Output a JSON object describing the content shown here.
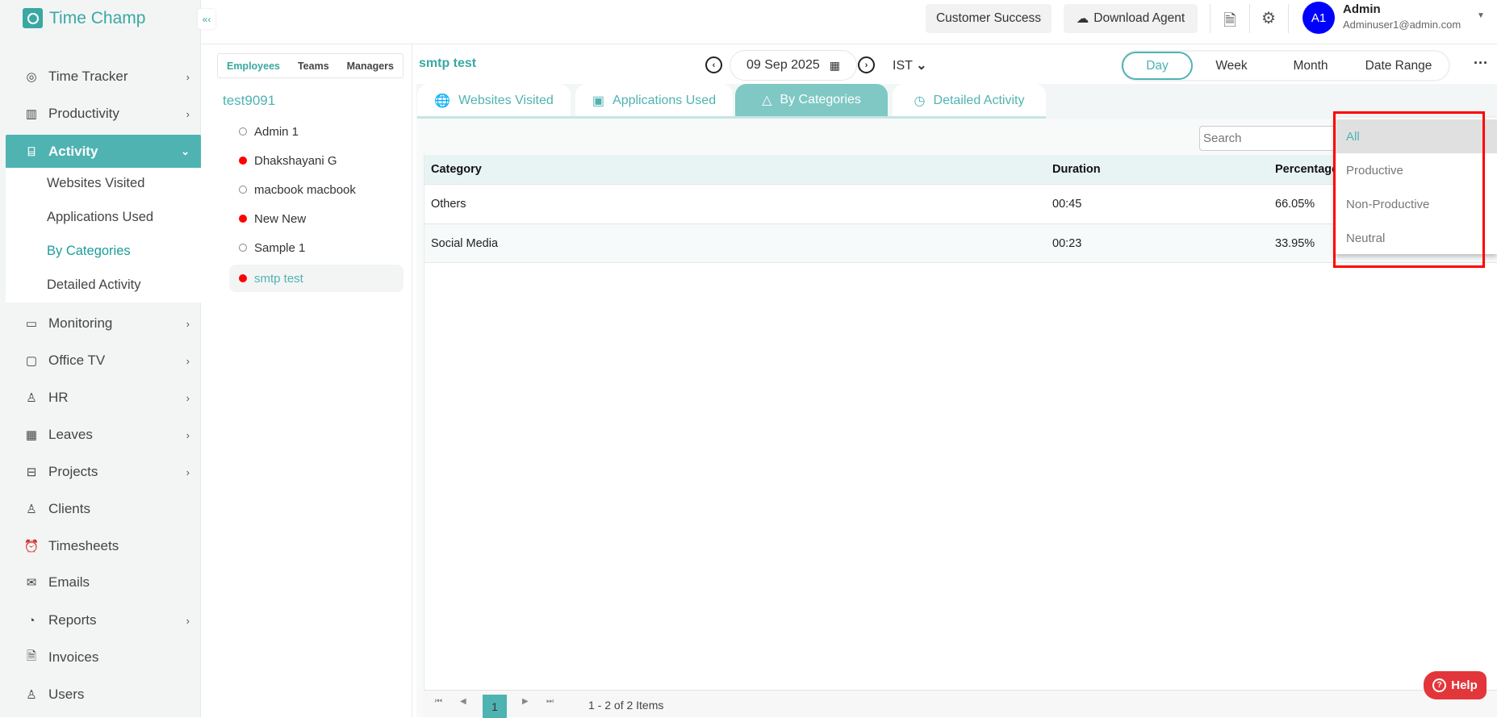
{
  "app": {
    "name": "Time Champ"
  },
  "header": {
    "customer_success": "Customer Success",
    "download_agent": "Download Agent",
    "user": {
      "initials": "A1",
      "name": "Admin",
      "email": "Adminuser1@admin.com"
    }
  },
  "sidebar": {
    "items": [
      {
        "label": "Time Tracker",
        "icon": "timer-icon"
      },
      {
        "label": "Productivity",
        "icon": "chart-icon"
      },
      {
        "label": "Activity",
        "icon": "ticket-icon"
      },
      {
        "label": "Monitoring",
        "icon": "monitor-icon"
      },
      {
        "label": "Office TV",
        "icon": "tv-icon"
      },
      {
        "label": "HR",
        "icon": "person-icon"
      },
      {
        "label": "Leaves",
        "icon": "calendar-icon"
      },
      {
        "label": "Projects",
        "icon": "briefcase-icon"
      },
      {
        "label": "Clients",
        "icon": "client-icon"
      },
      {
        "label": "Timesheets",
        "icon": "alarm-icon"
      },
      {
        "label": "Emails",
        "icon": "mail-icon"
      },
      {
        "label": "Reports",
        "icon": "pie-icon"
      },
      {
        "label": "Invoices",
        "icon": "invoice-icon"
      },
      {
        "label": "Users",
        "icon": "users-icon"
      }
    ],
    "activity_sub": [
      "Websites Visited",
      "Applications Used",
      "By Categories",
      "Detailed Activity"
    ]
  },
  "employees": {
    "tabs": [
      "Employees",
      "Teams",
      "Managers"
    ],
    "group": "test9091",
    "list": [
      {
        "name": "Admin 1",
        "online": false
      },
      {
        "name": "Dhakshayani G",
        "online": true
      },
      {
        "name": "macbook macbook",
        "online": false
      },
      {
        "name": "New New",
        "online": true
      },
      {
        "name": "Sample 1",
        "online": false
      },
      {
        "name": "smtp test",
        "online": true
      }
    ]
  },
  "main": {
    "title": "smtp test",
    "date": "09 Sep 2025",
    "timezone": "IST",
    "ranges": [
      "Day",
      "Week",
      "Month",
      "Date Range"
    ],
    "tabs": [
      "Websites Visited",
      "Applications Used",
      "By Categories",
      "Detailed Activity"
    ],
    "search_placeholder": "Search",
    "columns": [
      "Category",
      "Duration",
      "Percentage"
    ],
    "rows": [
      {
        "category": "Others",
        "duration": "00:45",
        "percentage": "66.05%"
      },
      {
        "category": "Social Media",
        "duration": "00:23",
        "percentage": "33.95%"
      }
    ],
    "pager": {
      "page": "1",
      "summary": "1 - 2 of 2 Items"
    }
  },
  "filter_dropdown": [
    "All",
    "Productive",
    "Non-Productive",
    "Neutral"
  ],
  "help": "Help",
  "colors": {
    "accent": "#4fb3b1",
    "highlight": "#ff0000",
    "help": "#e3363b"
  }
}
